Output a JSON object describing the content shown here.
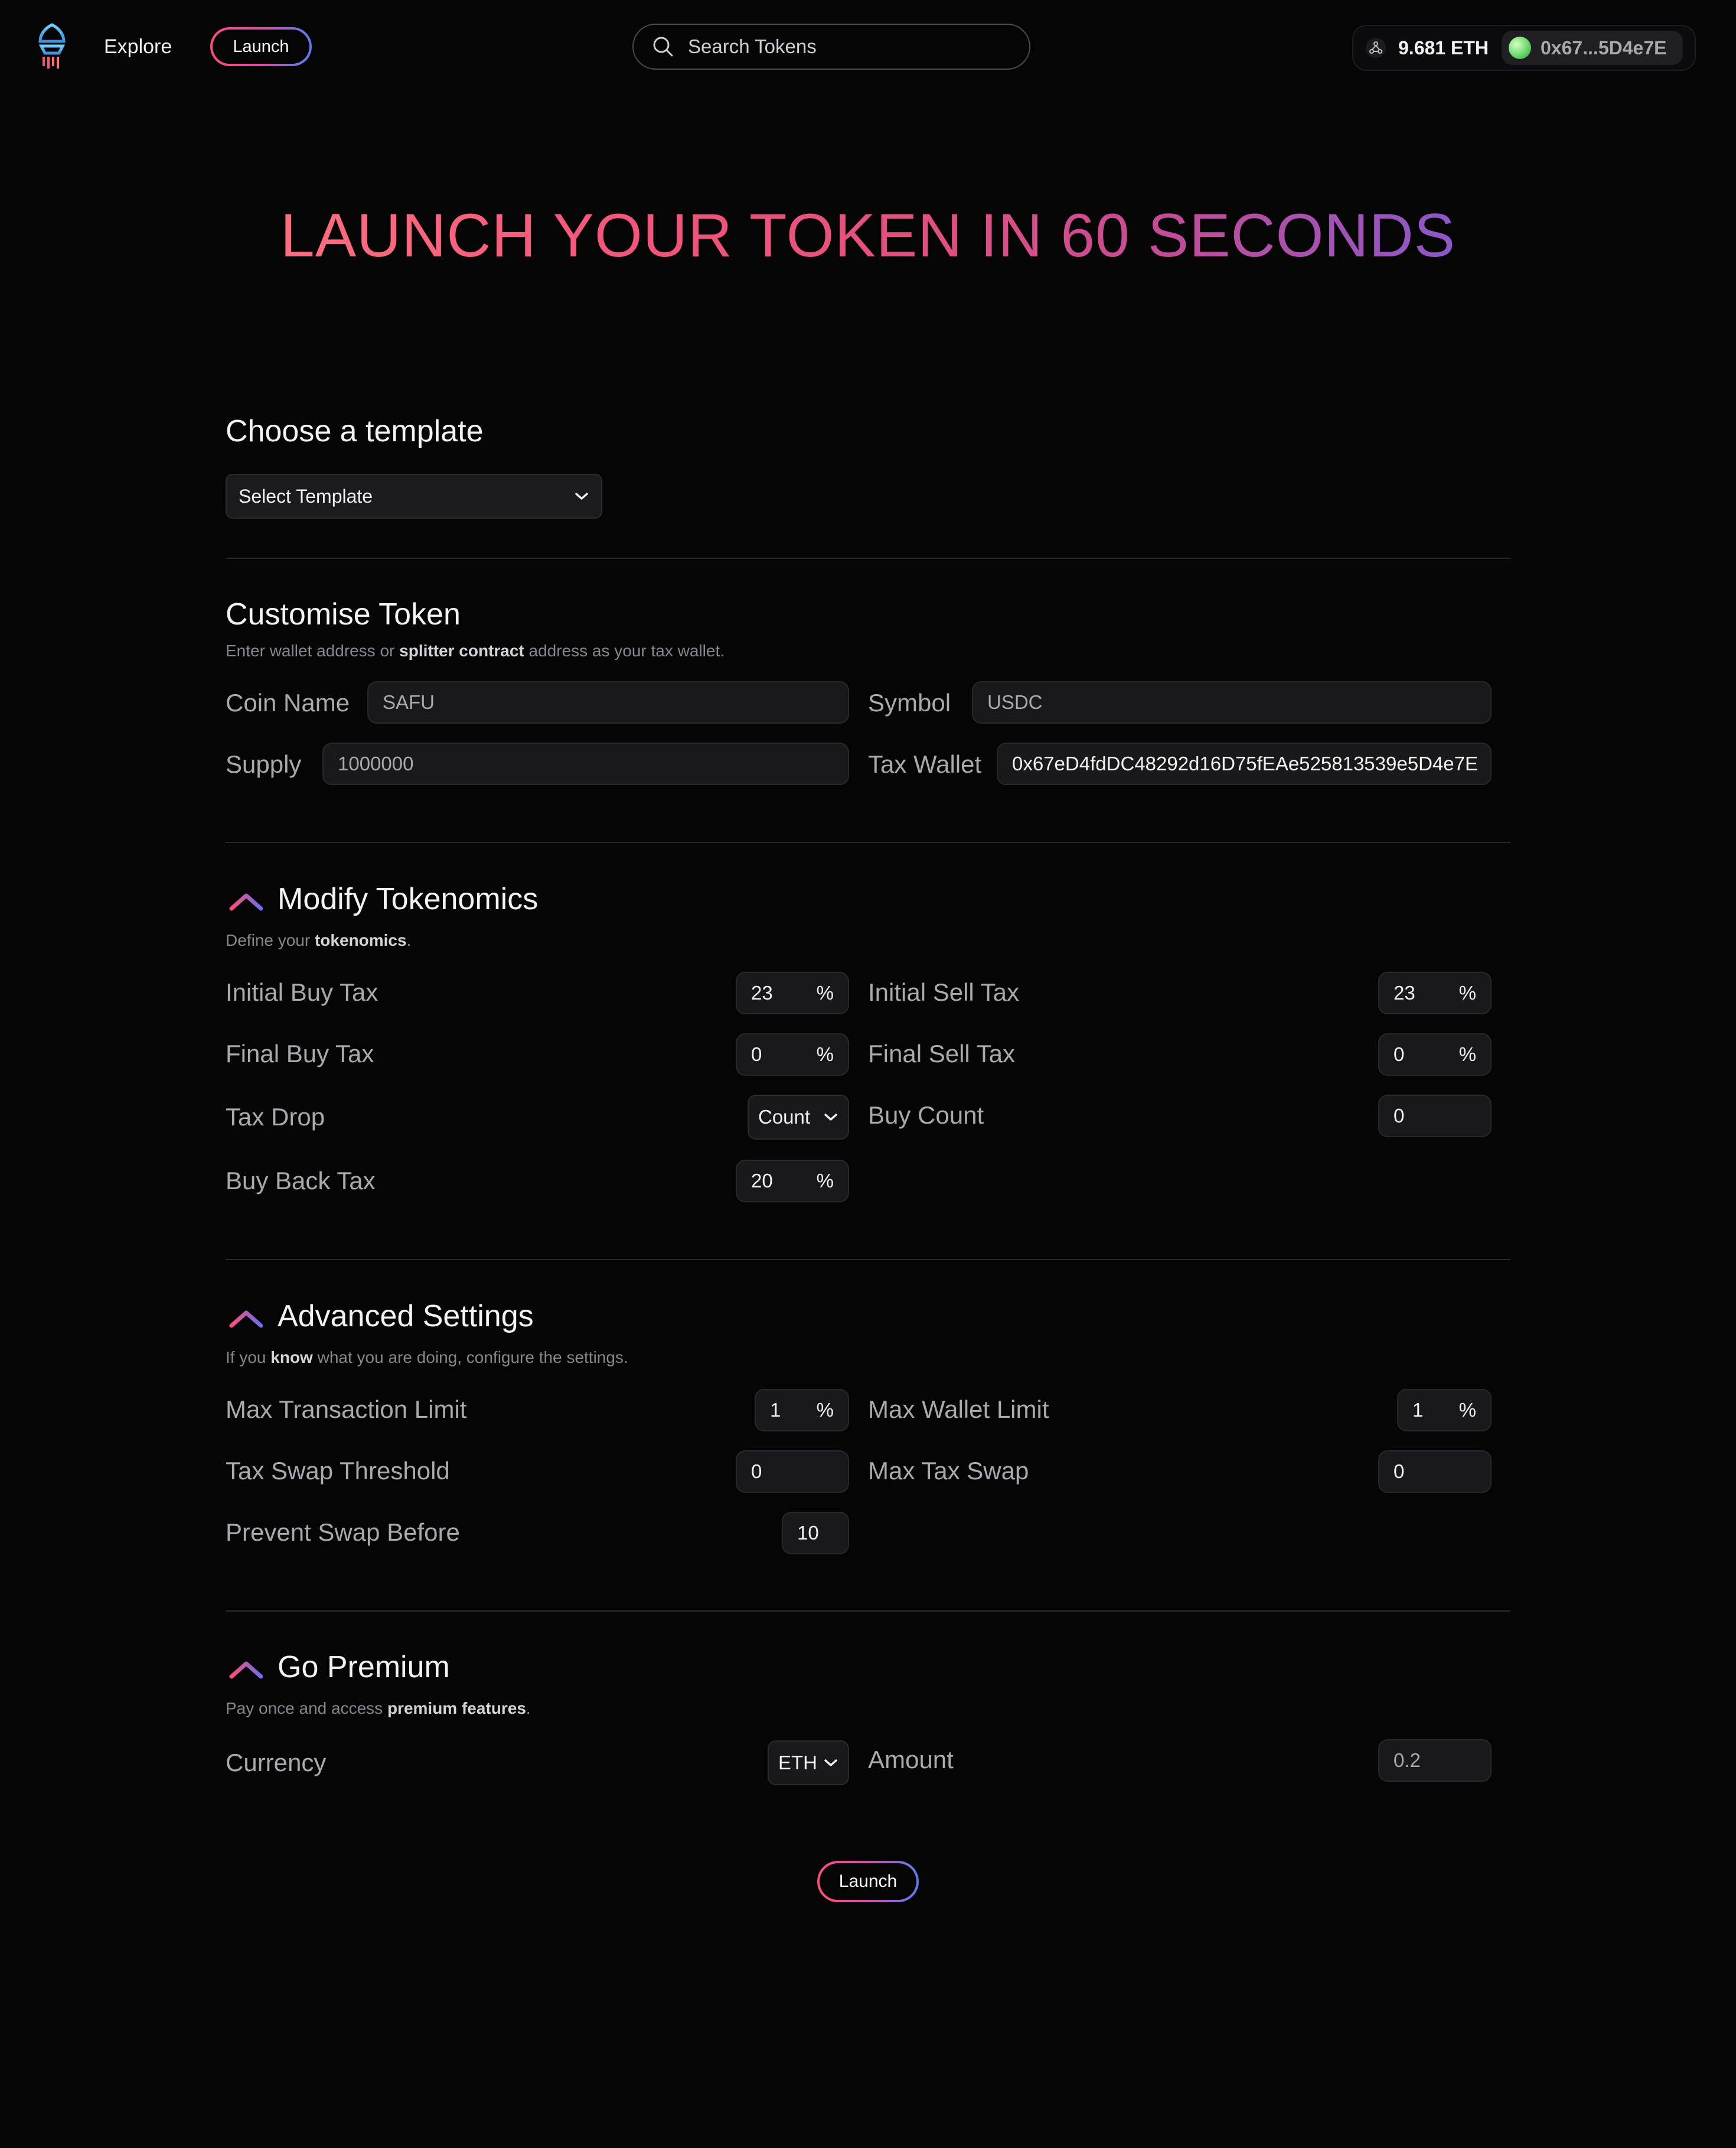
{
  "nav": {
    "explore": "Explore",
    "launch": "Launch",
    "search_placeholder": "Search Tokens",
    "eth_balance": "9.681 ETH",
    "wallet_address": "0x67...5D4e7E"
  },
  "hero": {
    "title": "LAUNCH YOUR TOKEN IN 60 SECONDS"
  },
  "template": {
    "heading": "Choose a template",
    "select_value": "Select Template"
  },
  "customise": {
    "heading": "Customise Token",
    "sub_pre": "Enter wallet address or ",
    "sub_bold": "splitter contract",
    "sub_post": " address as your tax wallet.",
    "coin_name_label": "Coin Name",
    "coin_name_placeholder": "SAFU",
    "symbol_label": "Symbol",
    "symbol_placeholder": "USDC",
    "supply_label": "Supply",
    "supply_placeholder": "1000000",
    "tax_wallet_label": "Tax Wallet",
    "tax_wallet_value": "0x67eD4fdDC48292d16D75fEAe525813539e5D4e7E"
  },
  "tokenomics": {
    "heading": "Modify Tokenomics",
    "sub_pre": "Define your ",
    "sub_bold": "tokenomics",
    "sub_post": ".",
    "initial_buy_tax_label": "Initial Buy Tax",
    "initial_buy_tax": "23",
    "initial_sell_tax_label": "Initial Sell Tax",
    "initial_sell_tax": "23",
    "final_buy_tax_label": "Final Buy Tax",
    "final_buy_tax": "0",
    "final_sell_tax_label": "Final Sell Tax",
    "final_sell_tax": "0",
    "tax_drop_label": "Tax Drop",
    "tax_drop_value": "Count",
    "buy_count_label": "Buy Count",
    "buy_count": "0",
    "buy_back_tax_label": "Buy Back Tax",
    "buy_back_tax": "20",
    "percent": "%"
  },
  "advanced": {
    "heading": "Advanced Settings",
    "sub_pre": "If you ",
    "sub_bold": "know",
    "sub_post": " what you are doing, configure the settings.",
    "max_tx_label": "Max Transaction Limit",
    "max_tx": "1",
    "max_wallet_label": "Max Wallet Limit",
    "max_wallet": "1",
    "swap_threshold_label": "Tax Swap Threshold",
    "swap_threshold": "0",
    "max_tax_swap_label": "Max Tax Swap",
    "max_tax_swap": "0",
    "prevent_swap_label": "Prevent Swap Before",
    "prevent_swap": "10"
  },
  "premium": {
    "heading": "Go Premium",
    "sub_pre": "Pay once and access ",
    "sub_bold": "premium features",
    "sub_post": ".",
    "currency_label": "Currency",
    "currency_value": "ETH",
    "amount_label": "Amount",
    "amount_placeholder": "0.2"
  },
  "footer": {
    "launch": "Launch"
  },
  "colors": {
    "background": "#050505",
    "gradient_start": "#ff4d7a",
    "gradient_mid": "#d84fa8",
    "gradient_end": "#5a7cf0"
  },
  "icons": {
    "logo": "logo-icon",
    "search": "search-icon",
    "eth": "eth-network-icon",
    "section": "caret-up-gradient-icon",
    "dropdown": "chevron-down-icon"
  }
}
